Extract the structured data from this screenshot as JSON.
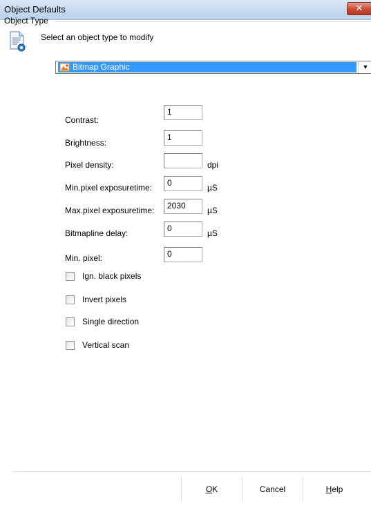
{
  "window": {
    "title": "Object Defaults",
    "close_label": "✕"
  },
  "group": {
    "label": "Object Type",
    "hint": "Select an object type to modify",
    "icon": "document-settings-icon"
  },
  "object_type": {
    "selected": "Bitmap Graphic",
    "icon": "bitmap-graphic-icon"
  },
  "fields": {
    "contrast": {
      "label": "Contrast:",
      "value": "1"
    },
    "brightness": {
      "label": "Brightness:",
      "value": "1"
    },
    "pixel_density": {
      "label": "Pixel density:",
      "value": "",
      "unit": "dpi"
    },
    "min_exposure": {
      "label": "Min.pixel exposuretime:",
      "value": "0",
      "unit": "µS"
    },
    "max_exposure": {
      "label": "Max.pixel exposuretime:",
      "value": "2030",
      "unit": "µS"
    },
    "bitmapline_delay": {
      "label": "Bitmapline delay:",
      "value": "0",
      "unit": "µS"
    },
    "min_pixel": {
      "label": "Min. pixel:",
      "value": "0"
    }
  },
  "checkboxes": {
    "ign_black": {
      "label": "Ign. black pixels",
      "checked": false
    },
    "invert": {
      "label": "Invert pixels",
      "checked": false
    },
    "single_direction": {
      "label": "Single direction",
      "checked": false
    },
    "vertical_scan": {
      "label": "Vertical scan",
      "checked": false
    }
  },
  "buttons": {
    "ok": {
      "mnemonic": "O",
      "rest": "K"
    },
    "cancel": "Cancel",
    "help": {
      "mnemonic": "H",
      "rest": "elp"
    }
  },
  "colors": {
    "selection": "#3399ff",
    "close_button": "#c94a34",
    "titlebar": "#c5d8ef"
  }
}
